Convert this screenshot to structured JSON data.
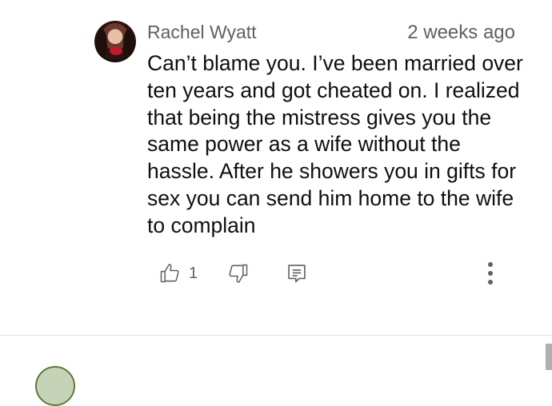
{
  "comment": {
    "author": "Rachel Wyatt",
    "timestamp": "2 weeks ago",
    "text": "Can’t blame you. I’ve been married over ten years and got cheated on. I realized that being the mistress gives you the same power as a wife without the hassle. After he showers you in gifts for sex you can send him home to the wife to complain",
    "like_count": "1"
  },
  "icons": {
    "like": "thumbs-up-icon",
    "dislike": "thumbs-down-icon",
    "reply": "reply-icon",
    "menu": "more-vertical-icon"
  },
  "colors": {
    "secondary_text": "#606060",
    "primary_text": "#0f0f0f",
    "icon": "#606060"
  }
}
